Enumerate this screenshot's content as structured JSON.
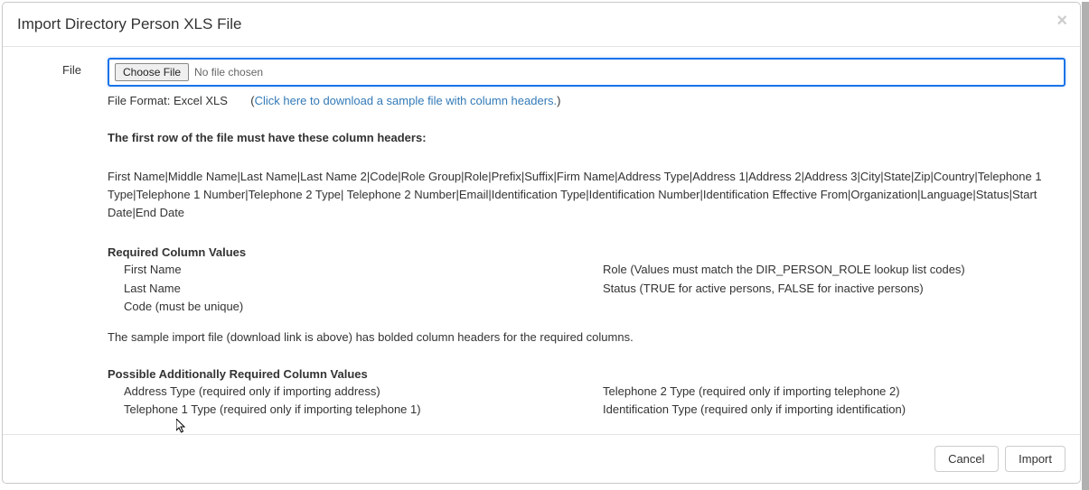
{
  "modal": {
    "title": "Import Directory Person XLS File",
    "close_label": "×"
  },
  "form": {
    "file_label": "File",
    "choose_button": "Choose File",
    "file_status": "No file chosen",
    "format_prefix": "File Format: Excel XLS",
    "download_link_open": "(",
    "download_link_text": "Click here to download a sample file with column headers.",
    "download_link_close": ")"
  },
  "headers": {
    "instruction": "The first row of the file must have these column headers:",
    "list": "First Name|Middle Name|Last Name|Last Name 2|Code|Role Group|Role|Prefix|Suffix|Firm Name|Address Type|Address 1|Address 2|Address 3|City|State|Zip|Country|Telephone 1 Type|Telephone 1 Number|Telephone 2 Type| Telephone 2 Number|Email|Identification Type|Identification Number|Identification Effective From|Organization|Language|Status|Start Date|End Date"
  },
  "required": {
    "title": "Required Column Values",
    "left": {
      "0": "First Name",
      "1": "Last Name",
      "2": "Code (must be unique)"
    },
    "right": {
      "0": "Role (Values must match the DIR_PERSON_ROLE lookup list codes)",
      "1": "Status (TRUE for active persons, FALSE for inactive persons)"
    }
  },
  "note": "The sample import file (download link is above) has bolded column headers for the required columns.",
  "additional": {
    "title": "Possible Additionally Required Column Values",
    "left": {
      "0": "Address Type (required only if importing address)",
      "1": "Telephone 1 Type (required only if importing telephone 1)"
    },
    "right": {
      "0": "Telephone 2 Type (required only if importing telephone 2)",
      "1": "Identification Type (required only if importing identification)"
    }
  },
  "footer": {
    "cancel": "Cancel",
    "import": "Import"
  }
}
